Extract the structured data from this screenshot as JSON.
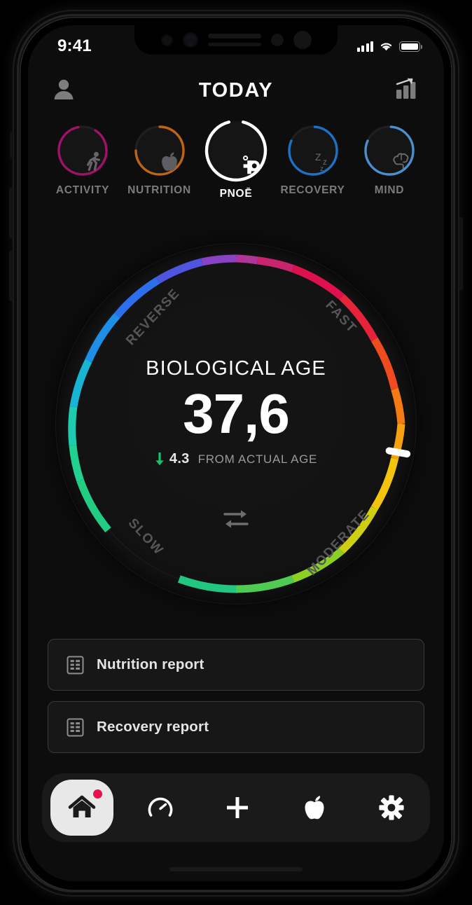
{
  "status_bar": {
    "time": "9:41",
    "signal_icon": "cellular-bars-icon",
    "wifi_icon": "wifi-icon",
    "battery_icon": "battery-icon"
  },
  "header": {
    "title": "TODAY",
    "profile_icon": "profile-icon",
    "stats_icon": "bar-chart-trend-icon"
  },
  "categories": [
    {
      "label": "ACTIVITY",
      "icon": "running-person-icon",
      "color": "#A01269",
      "ring_pct": 88,
      "ring_start": -60,
      "active": false
    },
    {
      "label": "NUTRITION",
      "icon": "apple-icon",
      "color": "#C06412",
      "ring_pct": 76,
      "ring_start": -90,
      "active": false
    },
    {
      "label": "PNOĒ",
      "icon": "pnoe-logo-icon",
      "color": "#FFFFFF",
      "ring_pct": 92,
      "ring_start": -78,
      "active": true
    },
    {
      "label": "RECOVERY",
      "icon": "sleep-zzz-icon",
      "color": "#1B72C4",
      "ring_pct": 80,
      "ring_start": -90,
      "active": false
    },
    {
      "label": "MIND",
      "icon": "brain-icon",
      "color": "#4A90D0",
      "ring_pct": 80,
      "ring_start": -90,
      "active": false
    }
  ],
  "gauge": {
    "title": "BIOLOGICAL AGE",
    "value": "37,6",
    "delta_direction_icon": "arrow-down-icon",
    "delta_value": "4.3",
    "delta_caption": "FROM ACTUAL AGE",
    "delta_color": "#11C56B",
    "swap_icon": "swap-arrows-icon",
    "marker_angle_deg": 190,
    "zone_labels": {
      "reverse": "REVERSE",
      "fast": "FAST",
      "slow": "SLOW",
      "moderate": "MODERATE"
    }
  },
  "chart_data": {
    "type": "gauge",
    "title": "BIOLOGICAL AGE",
    "value": 37.6,
    "value_display": "37,6",
    "delta": -4.3,
    "delta_label": "4.3 FROM ACTUAL AGE",
    "marker_angle_deg": 190,
    "ring_sweep_deg": 320,
    "ring_start_deg": 110,
    "zones": [
      {
        "name": "SLOW",
        "angle_deg": 225,
        "color": "#22C55E"
      },
      {
        "name": "REVERSE",
        "angle_deg": 135,
        "color": "#2C7EF0"
      },
      {
        "name": "FAST",
        "angle_deg": 45,
        "color": "#E0154C"
      },
      {
        "name": "MODERATE",
        "angle_deg": 315,
        "color": "#F6A60C"
      }
    ],
    "gradient_stops": [
      {
        "offset": 0.0,
        "color": "#2DD4A0"
      },
      {
        "offset": 0.08,
        "color": "#1FBFBF"
      },
      {
        "offset": 0.2,
        "color": "#1E8FE8"
      },
      {
        "offset": 0.31,
        "color": "#2C6FE8"
      },
      {
        "offset": 0.4,
        "color": "#7C4FD6"
      },
      {
        "offset": 0.47,
        "color": "#B23BB0"
      },
      {
        "offset": 0.55,
        "color": "#E0154C"
      },
      {
        "offset": 0.66,
        "color": "#EE4422"
      },
      {
        "offset": 0.76,
        "color": "#F58A10"
      },
      {
        "offset": 0.84,
        "color": "#F6C90C"
      },
      {
        "offset": 0.9,
        "color": "#C9D117"
      },
      {
        "offset": 0.96,
        "color": "#47C83E"
      },
      {
        "offset": 1.0,
        "color": "#18D28A"
      }
    ],
    "grid": false,
    "legend": "none"
  },
  "reports": [
    {
      "label": "Nutrition report",
      "icon": "report-document-icon"
    },
    {
      "label": "Recovery report",
      "icon": "report-document-icon"
    }
  ],
  "tabbar": [
    {
      "name": "home",
      "icon": "home-icon",
      "active": true,
      "badge": true
    },
    {
      "name": "dashboard",
      "icon": "gauge-icon",
      "active": false,
      "badge": false
    },
    {
      "name": "add",
      "icon": "plus-icon",
      "active": false,
      "badge": false
    },
    {
      "name": "nutrition",
      "icon": "apple-icon",
      "active": false,
      "badge": false
    },
    {
      "name": "settings",
      "icon": "gear-icon",
      "active": false,
      "badge": false
    }
  ],
  "colors": {
    "background": "#0d0d0d",
    "accent_red": "#e8114e",
    "green": "#11C56B",
    "muted_text": "#7b7b7e"
  }
}
